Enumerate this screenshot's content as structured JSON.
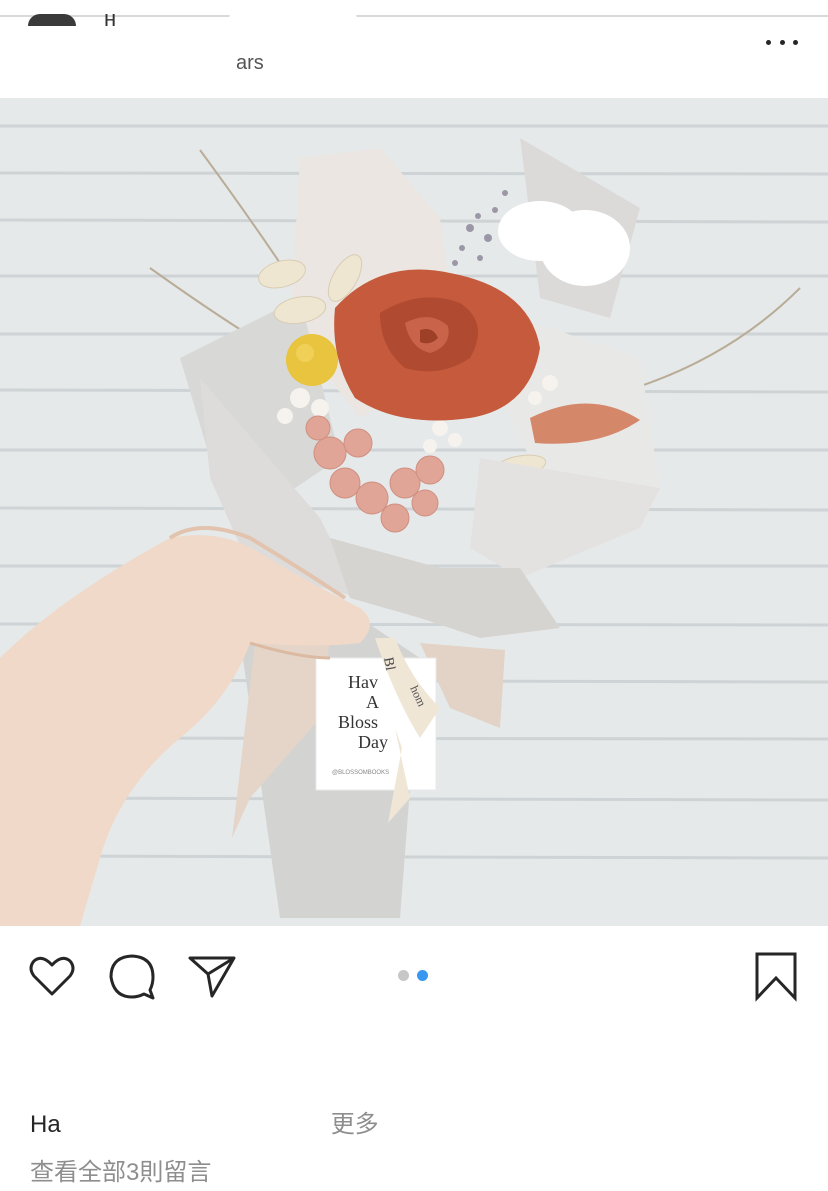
{
  "post": {
    "username_fragment": "н",
    "subline_fragment": "ars",
    "more_icon": "more-horizontal-icon"
  },
  "photo": {
    "card_lines": [
      "Hav",
      "A",
      "Bloss",
      "Day"
    ],
    "ribbon_text": "Bl",
    "ribbon_text_2": "hom",
    "card_small": "@BLOSSOMBOOKS",
    "wall_color": "#e6e9ea",
    "rose_color": "#c55a3c"
  },
  "actions": {
    "like_icon": "heart-icon",
    "comment_icon": "comment-bubble-icon",
    "share_icon": "paper-plane-icon",
    "save_icon": "bookmark-icon",
    "carousel": {
      "count": 2,
      "active_index": 1,
      "active_color": "#3897f0",
      "inactive_color": "#c7c7c7"
    }
  },
  "caption": {
    "start": "Ha",
    "end": "更多"
  },
  "comments": {
    "view_all_label": "查看全部3則留言"
  }
}
